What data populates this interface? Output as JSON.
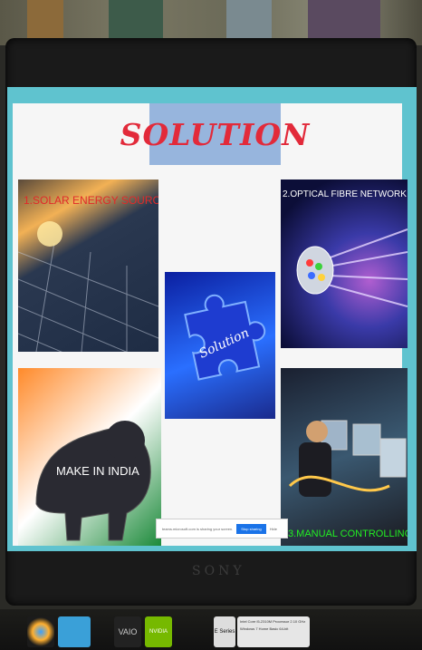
{
  "slide": {
    "title": "SOLUTION",
    "panels": [
      {
        "label": "1.SOLAR ENERGY SOURCE",
        "color": "#e02a2a"
      },
      {
        "label": "2.OPTICAL FIBRE NETWORK",
        "color": "#ffffff"
      },
      {
        "label": "Solution",
        "color": "#ffffff"
      },
      {
        "label": "MAKE IN INDIA",
        "color": "#ffffff"
      },
      {
        "label": "3.MANUAL CONTROLLING",
        "color": "#22ee22"
      }
    ]
  },
  "share_bar": {
    "message": "teams.microsoft.com is sharing your screen.",
    "stop_label": "Stop sharing",
    "hide_label": "Hide"
  },
  "laptop": {
    "brand": "SONY",
    "stickers": [
      "VAIO",
      "NVIDIA",
      "E Series",
      "Intel Core i5-2310M Processor 2.10 GHz",
      "Windows 7 Home Basic 64-bit"
    ]
  }
}
